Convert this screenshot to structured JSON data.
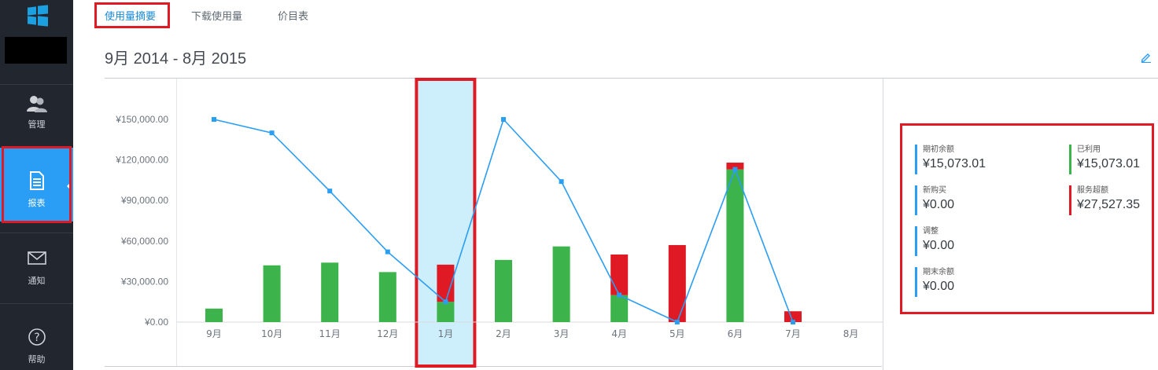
{
  "sidebar": {
    "items": [
      {
        "label": "管理",
        "icon": "users-icon"
      },
      {
        "label": "报表",
        "icon": "report-icon"
      },
      {
        "label": "通知",
        "icon": "mail-icon"
      },
      {
        "label": "帮助",
        "icon": "help-icon"
      }
    ],
    "active": "报表"
  },
  "tabs": [
    "使用量摘要",
    "下载使用量",
    "价目表"
  ],
  "active_tab": "使用量摘要",
  "page_title": "9月 2014 - 8月 2015",
  "colors": {
    "accent": "#2a9df4",
    "link": "#1a8ad4",
    "sidebar_bg": "#22262f",
    "bar_used": "#3cb44b",
    "bar_overage": "#e01a24",
    "line": "#2a9df4",
    "highlight": "#cdeefb",
    "frame": "#e01a24"
  },
  "chart_data": {
    "type": "bar",
    "categories": [
      "9月",
      "10月",
      "11月",
      "12月",
      "1月",
      "2月",
      "3月",
      "4月",
      "5月",
      "6月",
      "7月",
      "8月"
    ],
    "series": [
      {
        "values": [
          10000,
          42000,
          44000,
          37000,
          15000,
          46000,
          56000,
          20000,
          0,
          113000,
          0,
          0
        ]
      },
      {
        "values": [
          0,
          0,
          0,
          0,
          27500,
          0,
          0,
          30000,
          57000,
          5000,
          8000,
          0
        ]
      },
      {
        "type": "line",
        "values": [
          150000,
          140000,
          97000,
          52000,
          15000,
          150000,
          104000,
          20000,
          0,
          113000,
          0,
          null
        ]
      }
    ],
    "y_ticks": [
      "¥0.00",
      "¥30,000.00",
      "¥60,000.00",
      "¥90,000.00",
      "¥120,000.00",
      "¥150,000.00"
    ],
    "ylim": [
      0,
      150000
    ],
    "highlighted_category": "1月",
    "grid": false,
    "stacked": true
  },
  "summary": [
    {
      "label": "期初余额",
      "value": "¥15,073.01",
      "color": "#2a9df4"
    },
    {
      "label": "已利用",
      "value": "¥15,073.01",
      "color": "#3cb44b"
    },
    {
      "label": "新购买",
      "value": "¥0.00",
      "color": "#2a9df4"
    },
    {
      "label": "服务超额",
      "value": "¥27,527.35",
      "color": "#e01a24"
    },
    {
      "label": "调整",
      "value": "¥0.00",
      "color": "#2a9df4"
    },
    {
      "label": "期末余额",
      "value": "¥0.00",
      "color": "#2a9df4"
    }
  ]
}
